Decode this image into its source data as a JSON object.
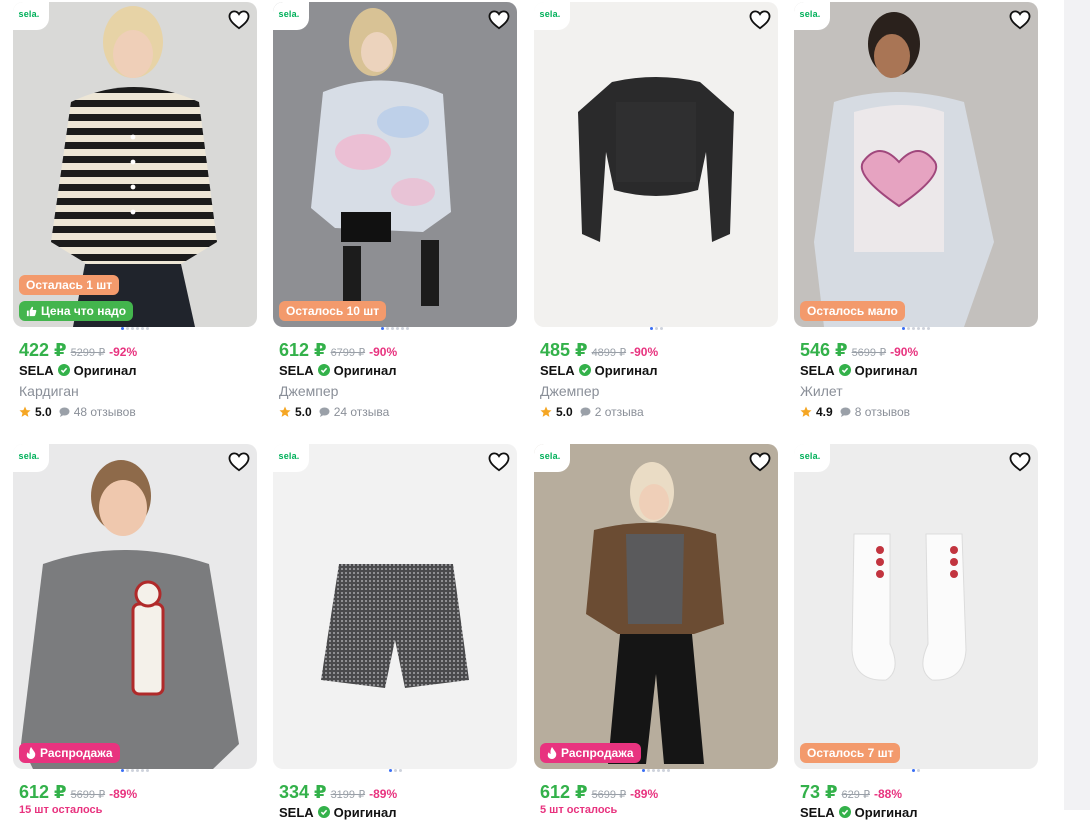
{
  "brand_logo_text": "sela.",
  "products": [
    {
      "price": "422 ₽",
      "old_price": "5299 ₽",
      "discount": "-92%",
      "brand": "SELA",
      "original_label": "Оригинал",
      "title": "Кардиган",
      "rating": "5.0",
      "reviews": "48 отзывов",
      "badges": [
        {
          "text": "Осталась 1 шт",
          "color": "orange"
        },
        {
          "text": "Цена что надо",
          "color": "green",
          "icon": "thumbs-up-icon"
        }
      ],
      "photo_slides": 6,
      "current_slide": 1
    },
    {
      "price": "612 ₽",
      "old_price": "6799 ₽",
      "discount": "-90%",
      "brand": "SELA",
      "original_label": "Оригинал",
      "title": "Джемпер",
      "rating": "5.0",
      "reviews": "24 отзыва",
      "badges": [
        {
          "text": "Осталось 10 шт",
          "color": "orange"
        }
      ],
      "photo_slides": 6,
      "current_slide": 1
    },
    {
      "price": "485 ₽",
      "old_price": "4899 ₽",
      "discount": "-90%",
      "brand": "SELA",
      "original_label": "Оригинал",
      "title": "Джемпер",
      "rating": "5.0",
      "reviews": "2 отзыва",
      "badges": [],
      "photo_slides": 3,
      "current_slide": 1
    },
    {
      "price": "546 ₽",
      "old_price": "5699 ₽",
      "discount": "-90%",
      "brand": "SELA",
      "original_label": "Оригинал",
      "title": "Жилет",
      "rating": "4.9",
      "reviews": "8 отзывов",
      "badges": [
        {
          "text": "Осталось мало",
          "color": "orange"
        }
      ],
      "photo_slides": 6,
      "current_slide": 1
    },
    {
      "price": "612 ₽",
      "old_price": "5699 ₽",
      "discount": "-89%",
      "stock_note": "15 шт осталось",
      "badges": [
        {
          "text": "Распродажа",
          "color": "pink",
          "icon": "fire-icon"
        }
      ],
      "photo_slides": 6,
      "current_slide": 1
    },
    {
      "price": "334 ₽",
      "old_price": "3199 ₽",
      "discount": "-89%",
      "brand": "SELA",
      "original_label": "Оригинал",
      "badges": [],
      "photo_slides": 3,
      "current_slide": 1
    },
    {
      "price": "612 ₽",
      "old_price": "5699 ₽",
      "discount": "-89%",
      "stock_note": "5 шт осталось",
      "badges": [
        {
          "text": "Распродажа",
          "color": "pink",
          "icon": "fire-icon"
        }
      ],
      "photo_slides": 6,
      "current_slide": 1
    },
    {
      "price": "73 ₽",
      "old_price": "629 ₽",
      "discount": "-88%",
      "brand": "SELA",
      "original_label": "Оригинал",
      "badges": [
        {
          "text": "Осталось 7 шт",
          "color": "orange"
        }
      ],
      "photo_slides": 2,
      "current_slide": 1
    }
  ],
  "colors": {
    "price_green": "#33b14a",
    "discount_pink": "#e8337f",
    "badge_orange": "#f39a6c",
    "badge_green": "#43b54d",
    "badge_pink": "#e8337f",
    "logo_green": "#00b05a"
  }
}
